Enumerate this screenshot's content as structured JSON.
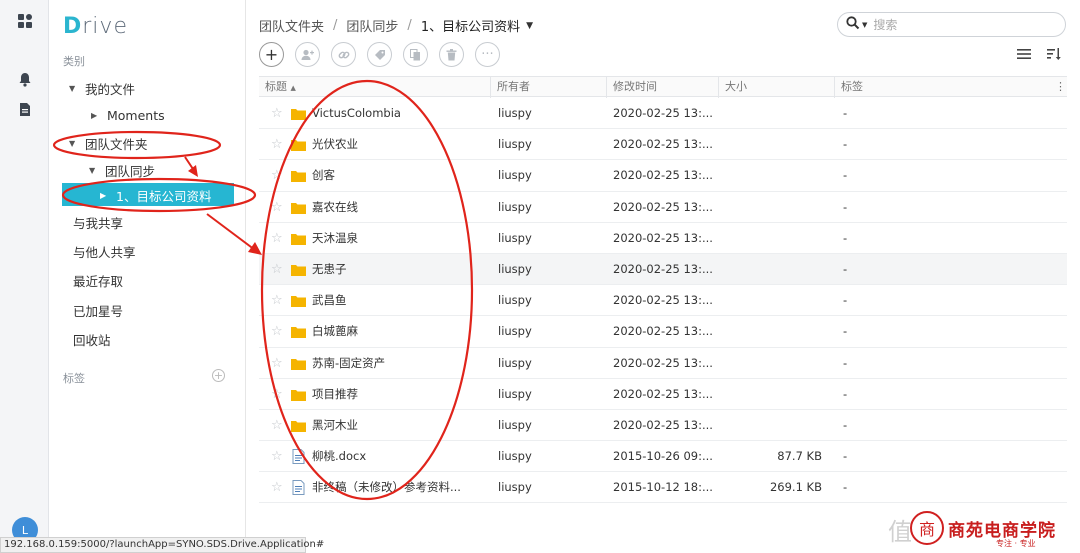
{
  "app": {
    "logo_text": "Drive",
    "status_url": "192.168.0.159:5000/?launchApp=SYNO.SDS.Drive.Application#",
    "avatar_letter": "L",
    "accent": "#26b6d2",
    "folder_color": "#f5b400"
  },
  "sidebar": {
    "section_category": "类别",
    "my_files": "我的文件",
    "moments": "Moments",
    "team_folder": "团队文件夹",
    "team_sync": "团队同步",
    "selected_folder": "1、目标公司资料",
    "shared_with_me": "与我共享",
    "shared_with_others": "与他人共享",
    "recent": "最近存取",
    "starred": "已加星号",
    "recycle": "回收站",
    "section_tags": "标签"
  },
  "breadcrumb": {
    "part1": "团队文件夹",
    "part2": "团队同步",
    "current": "1、目标公司资料",
    "sep": "/"
  },
  "search": {
    "placeholder": "搜索"
  },
  "table": {
    "headers": {
      "title": "标题",
      "owner": "所有者",
      "modified": "修改时间",
      "size": "大小",
      "tag": "标签"
    },
    "rows": [
      {
        "name": "VictusColombia",
        "owner": "liuspy",
        "modified": "2020-02-25 13:...",
        "size": "",
        "tag": "-",
        "type": "folder"
      },
      {
        "name": "光伏农业",
        "owner": "liuspy",
        "modified": "2020-02-25 13:...",
        "size": "",
        "tag": "-",
        "type": "folder"
      },
      {
        "name": "创客",
        "owner": "liuspy",
        "modified": "2020-02-25 13:...",
        "size": "",
        "tag": "-",
        "type": "folder"
      },
      {
        "name": "嘉农在线",
        "owner": "liuspy",
        "modified": "2020-02-25 13:...",
        "size": "",
        "tag": "-",
        "type": "folder"
      },
      {
        "name": "天沐温泉",
        "owner": "liuspy",
        "modified": "2020-02-25 13:...",
        "size": "",
        "tag": "-",
        "type": "folder"
      },
      {
        "name": "无患子",
        "owner": "liuspy",
        "modified": "2020-02-25 13:...",
        "size": "",
        "tag": "-",
        "type": "folder"
      },
      {
        "name": "武昌鱼",
        "owner": "liuspy",
        "modified": "2020-02-25 13:...",
        "size": "",
        "tag": "-",
        "type": "folder"
      },
      {
        "name": "白城蓖麻",
        "owner": "liuspy",
        "modified": "2020-02-25 13:...",
        "size": "",
        "tag": "-",
        "type": "folder"
      },
      {
        "name": "苏南-固定资产",
        "owner": "liuspy",
        "modified": "2020-02-25 13:...",
        "size": "",
        "tag": "-",
        "type": "folder"
      },
      {
        "name": "项目推荐",
        "owner": "liuspy",
        "modified": "2020-02-25 13:...",
        "size": "",
        "tag": "-",
        "type": "folder"
      },
      {
        "name": "黑河木业",
        "owner": "liuspy",
        "modified": "2020-02-25 13:...",
        "size": "",
        "tag": "-",
        "type": "folder"
      },
      {
        "name": "柳桃.docx",
        "owner": "liuspy",
        "modified": "2015-10-26 09:...",
        "size": "87.7 KB",
        "tag": "-",
        "type": "doc"
      },
      {
        "name": "非终稿（未修改）参考资料...",
        "owner": "liuspy",
        "modified": "2015-10-12 18:...",
        "size": "269.1 KB",
        "tag": "-",
        "type": "doc"
      }
    ]
  },
  "watermark": {
    "text": "商苑电商学院",
    "sub": "专注 · 专业",
    "seal": "商",
    "faint": "值"
  }
}
